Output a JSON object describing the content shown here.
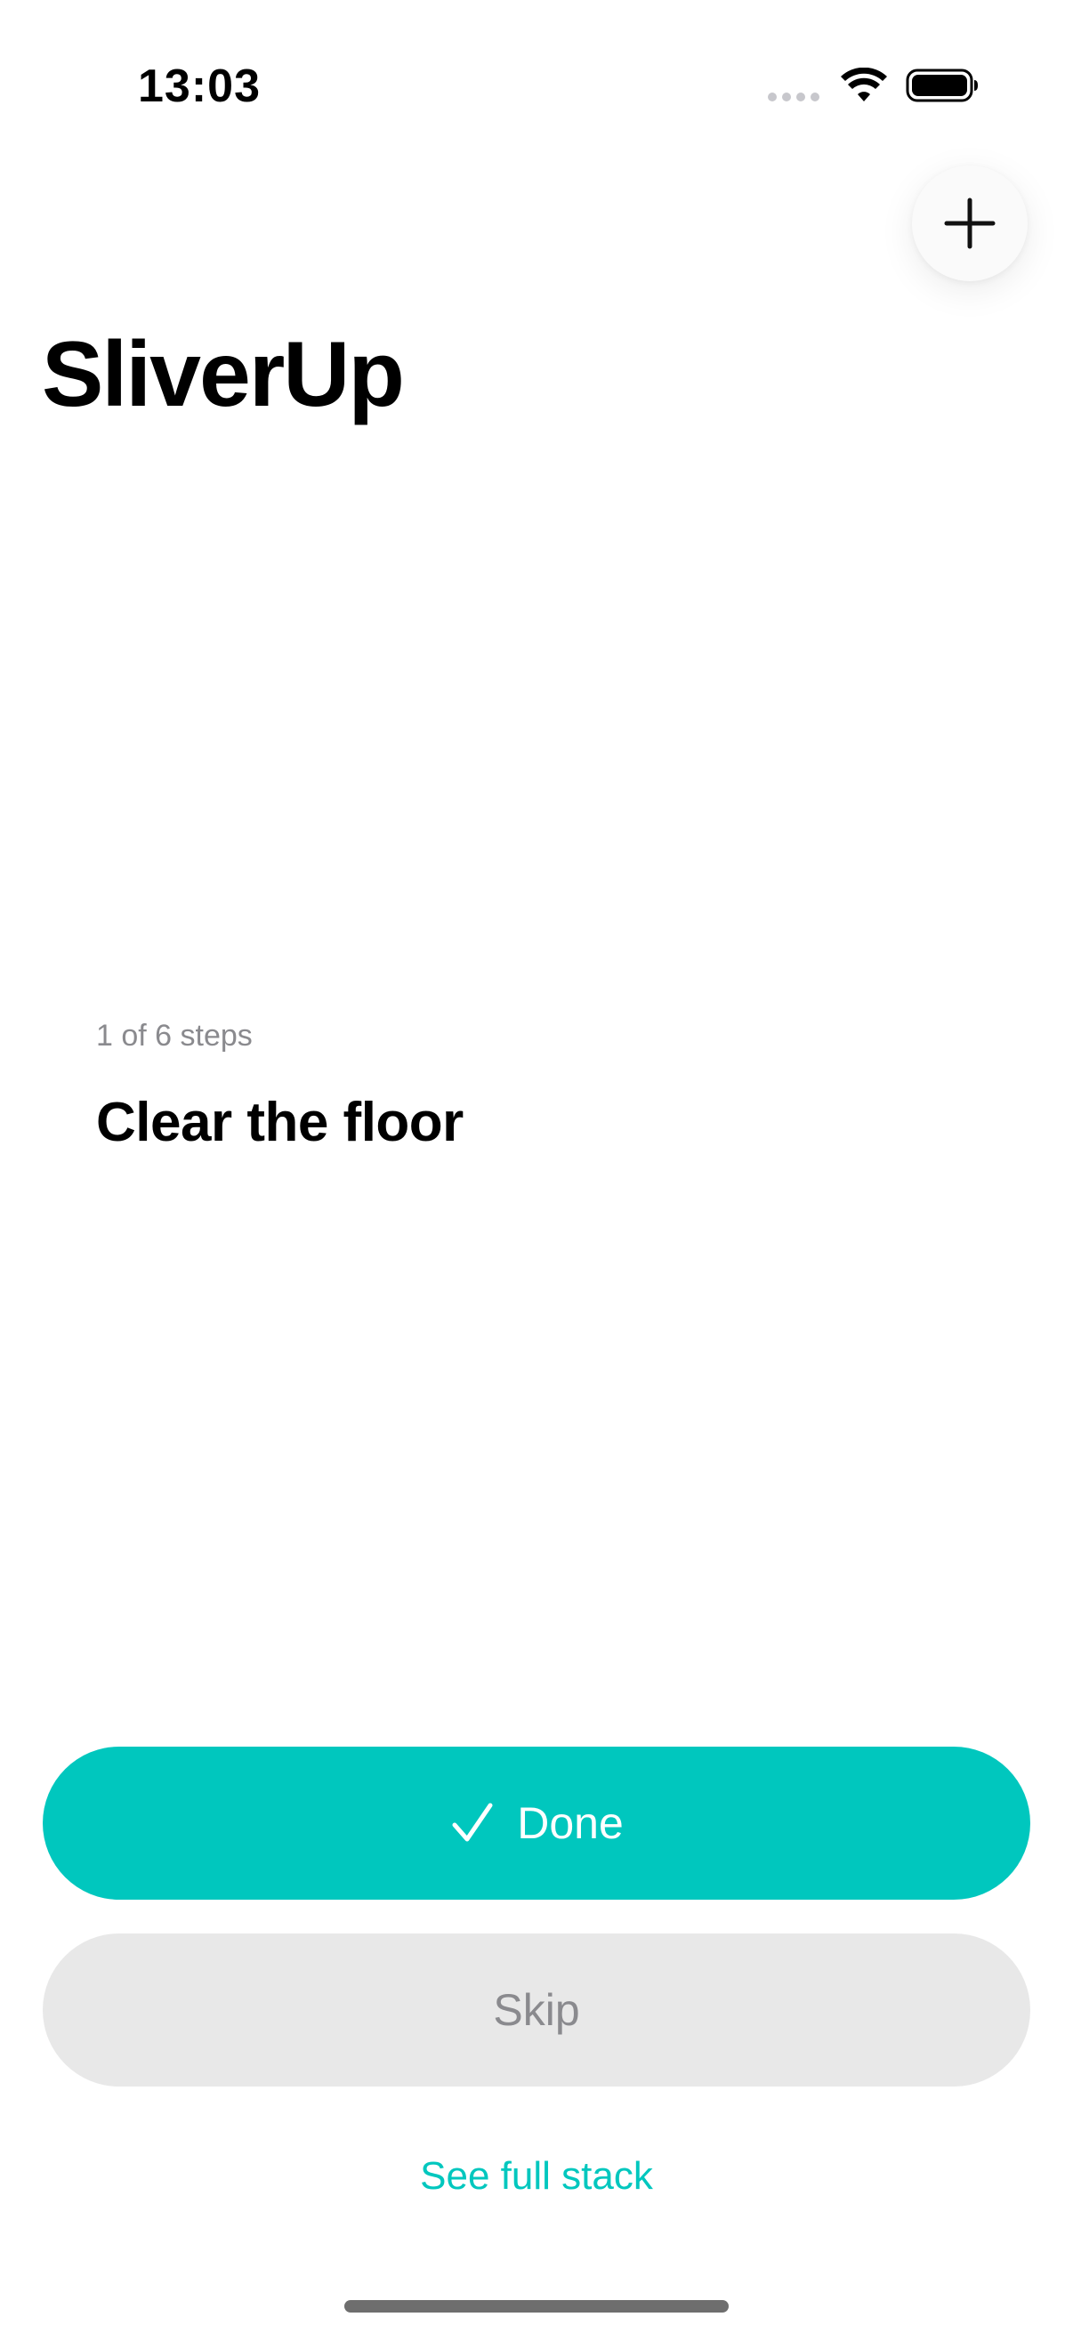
{
  "status_bar": {
    "time": "13:03",
    "icons": [
      "signal-dots-icon",
      "wifi-icon",
      "battery-icon"
    ]
  },
  "header": {
    "title": "SliverUp",
    "add_icon": "plus-icon"
  },
  "step": {
    "progress_text": "1 of 6 steps",
    "title": "Clear the floor"
  },
  "actions": {
    "done_label": "Done",
    "done_icon": "checkmark-icon",
    "skip_label": "Skip",
    "see_stack_label": "See full stack"
  },
  "colors": {
    "accent": "#00c7be",
    "secondary_button": "#e8e8e8",
    "muted_text": "#8a8a8e"
  }
}
